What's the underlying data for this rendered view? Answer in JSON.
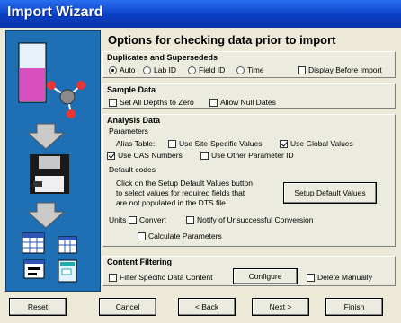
{
  "window": {
    "title": "Import Wizard"
  },
  "page": {
    "heading": "Options for checking data prior to  import"
  },
  "duplicates": {
    "title": "Duplicates and Supersededs",
    "options": [
      "Auto",
      "Lab ID",
      "Field ID",
      "Time"
    ],
    "selected": "Auto",
    "display_before_import": "Display Before Import"
  },
  "sample": {
    "title": "Sample Data",
    "set_depths": "Set All Depths to Zero",
    "allow_null": "Allow Null Dates"
  },
  "analysis": {
    "title": "Analysis Data",
    "parameters": "Parameters",
    "alias_table": "Alias Table:",
    "use_site_specific": "Use Site-Specific Values",
    "use_global": "Use Global Values",
    "use_cas": "Use CAS Numbers",
    "use_other_param": "Use Other Parameter ID",
    "default_codes": "Default codes",
    "default_desc_1": "Click on the Setup Default Values button",
    "default_desc_2": "to select values for required fields that",
    "default_desc_3": "are not populated in the DTS file.",
    "setup_default_values": "Setup Default Values",
    "units": "Units",
    "convert": "Convert",
    "notify": "Notify of Unsuccessful Conversion",
    "calculate": "Calculate Parameters"
  },
  "content": {
    "title": "Content Filtering",
    "filter": "Filter Specific Data Content",
    "configure": "Configure",
    "delete_manually": "Delete Manually"
  },
  "buttons": {
    "reset": "Reset",
    "cancel": "Cancel",
    "back": "< Back",
    "next": "Next >",
    "finish": "Finish"
  }
}
